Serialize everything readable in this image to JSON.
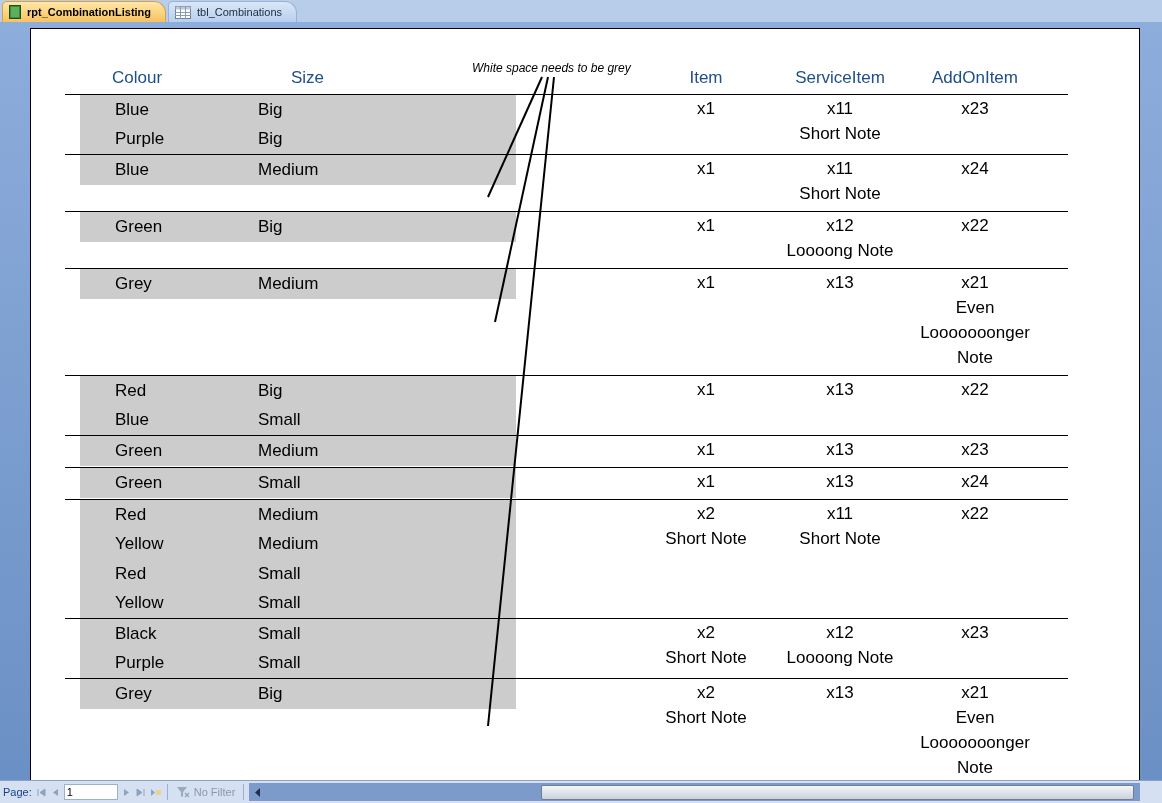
{
  "tabs": [
    {
      "label": "rpt_CombinationListing",
      "kind": "report",
      "selected": true
    },
    {
      "label": "tbl_Combinations",
      "kind": "table",
      "selected": false
    }
  ],
  "report": {
    "annotation": "White space needs to be grey",
    "columns": [
      "Colour",
      "Size",
      "Item",
      "ServiceItem",
      "AddOnItem"
    ],
    "groups": [
      {
        "combinations": [
          {
            "colour": "Blue",
            "size": "Big"
          },
          {
            "colour": "Purple",
            "size": "Big"
          }
        ],
        "item": [
          "x1"
        ],
        "service_item": [
          "x11",
          "Short Note"
        ],
        "add_on_item": [
          "x23"
        ]
      },
      {
        "combinations": [
          {
            "colour": "Blue",
            "size": "Medium"
          }
        ],
        "item": [
          "x1"
        ],
        "service_item": [
          "x11",
          "Short Note"
        ],
        "add_on_item": [
          "x24"
        ]
      },
      {
        "combinations": [
          {
            "colour": "Green",
            "size": "Big"
          }
        ],
        "item": [
          "x1"
        ],
        "service_item": [
          "x12",
          "Loooong Note"
        ],
        "add_on_item": [
          "x22"
        ]
      },
      {
        "combinations": [
          {
            "colour": "Grey",
            "size": "Medium"
          }
        ],
        "item": [
          "x1"
        ],
        "service_item": [
          "x13"
        ],
        "add_on_item": [
          "x21",
          "Even Looooooonger Note"
        ]
      },
      {
        "combinations": [
          {
            "colour": "Red",
            "size": "Big"
          },
          {
            "colour": "Blue",
            "size": "Small"
          }
        ],
        "item": [
          "x1"
        ],
        "service_item": [
          "x13"
        ],
        "add_on_item": [
          "x22"
        ]
      },
      {
        "combinations": [
          {
            "colour": "Green",
            "size": "Medium"
          }
        ],
        "item": [
          "x1"
        ],
        "service_item": [
          "x13"
        ],
        "add_on_item": [
          "x23"
        ]
      },
      {
        "combinations": [
          {
            "colour": "Green",
            "size": "Small"
          }
        ],
        "item": [
          "x1"
        ],
        "service_item": [
          "x13"
        ],
        "add_on_item": [
          "x24"
        ]
      },
      {
        "combinations": [
          {
            "colour": "Red",
            "size": "Medium"
          },
          {
            "colour": "Yellow",
            "size": "Medium"
          },
          {
            "colour": "Red",
            "size": "Small"
          },
          {
            "colour": "Yellow",
            "size": "Small"
          }
        ],
        "item": [
          "x2",
          "Short Note"
        ],
        "service_item": [
          "x11",
          "Short Note"
        ],
        "add_on_item": [
          "x22"
        ]
      },
      {
        "combinations": [
          {
            "colour": "Black",
            "size": "Small"
          },
          {
            "colour": "Purple",
            "size": "Small"
          }
        ],
        "item": [
          "x2",
          "Short Note"
        ],
        "service_item": [
          "x12",
          "Loooong Note"
        ],
        "add_on_item": [
          "x23"
        ]
      },
      {
        "combinations": [
          {
            "colour": "Grey",
            "size": "Big"
          }
        ],
        "item": [
          "x2",
          "Short Note"
        ],
        "service_item": [
          "x13"
        ],
        "add_on_item": [
          "x21",
          "Even Looooooonger Note"
        ]
      }
    ]
  },
  "status_bar": {
    "page_label": "Page:",
    "page_value": "1",
    "filter": "No Filter"
  }
}
